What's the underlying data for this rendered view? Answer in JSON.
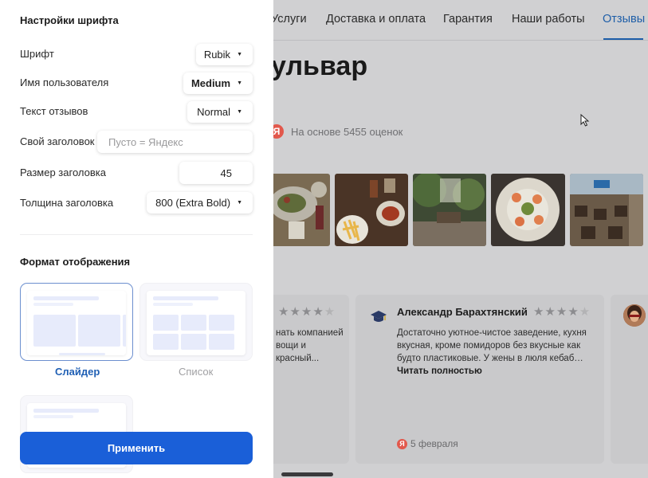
{
  "nav": {
    "items": [
      "Услуги",
      "Доставка и оплата",
      "Гарантия",
      "Наши работы",
      "Отзывы"
    ],
    "active": "Отзывы"
  },
  "page": {
    "title": "ульвар",
    "rating_text": "На основе 5455 оценок",
    "yandex_letter": "Я"
  },
  "photos": [
    "salad",
    "fries-and-drinks",
    "terrace",
    "shrimp-salad",
    "interior"
  ],
  "reviews": [
    {
      "text_lines": [
        "нать компанией",
        "вощи и",
        "красный..."
      ],
      "stars": 4
    },
    {
      "author": "Александр Барахтянский",
      "stars": 4,
      "text_lines": [
        "Достаточно уютное-чистое заведение, кухня",
        "вкусная, кроме помидоров без вкусные как",
        "будто пластиковые. У жены в люля кебаб…"
      ],
      "read_more": "Читать полностью",
      "date": "5 февраля",
      "avatar_icon": "graduation-cap-icon"
    }
  ],
  "panel": {
    "title": "Настройки шрифта",
    "rows": {
      "font": {
        "label": "Шрифт",
        "value": "Rubik"
      },
      "username": {
        "label": "Имя пользователя",
        "value": "Medium"
      },
      "review_text": {
        "label": "Текст отзывов",
        "value": "Normal"
      },
      "custom_title": {
        "label": "Свой заголовок",
        "placeholder": "Пусто = Яндекс"
      },
      "title_size": {
        "label": "Размер заголовка",
        "value": "45"
      },
      "title_weight": {
        "label": "Толщина заголовка",
        "value": "800 (Extra Bold)"
      }
    },
    "display_format": {
      "title": "Формат отображения",
      "options": [
        "Слайдер",
        "Список"
      ],
      "selected": "Слайдер"
    },
    "apply_label": "Применить"
  },
  "colors": {
    "accent": "#1a5fd8",
    "link_active": "#1e5ea8",
    "yandex_red": "#e2584c"
  }
}
